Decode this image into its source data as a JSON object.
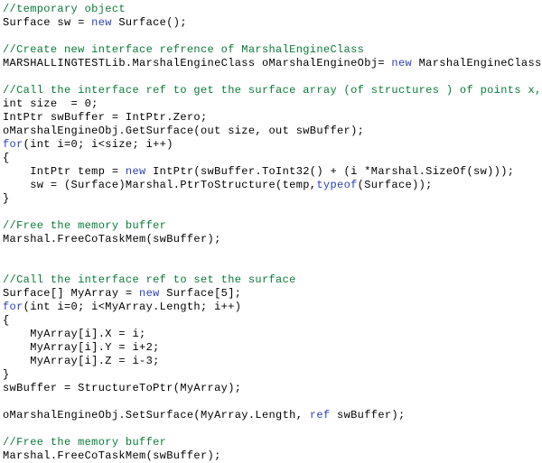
{
  "editor": {
    "language": "csharp",
    "background_color": "#ffffff",
    "default_text_color": "#000000",
    "comment_color": "#0a7a3a",
    "keyword_color": "#2b3fbd",
    "font_size_px": 12,
    "line_height_px": 15
  },
  "code": {
    "lines": [
      {
        "id": "line-1",
        "tokens": [
          {
            "t": "//temporary object",
            "k": "com"
          }
        ]
      },
      {
        "id": "line-2",
        "tokens": [
          {
            "t": "Surface sw = ",
            "k": "txt"
          },
          {
            "t": "new",
            "k": "kw"
          },
          {
            "t": " Surface();",
            "k": "txt"
          }
        ]
      },
      {
        "id": "line-3",
        "tokens": []
      },
      {
        "id": "line-4",
        "tokens": [
          {
            "t": "//Create new interface refrence of MarshalEngineClass",
            "k": "com"
          }
        ]
      },
      {
        "id": "line-5",
        "tokens": [
          {
            "t": "MARSHALLINGTESTLib.MarshalEngineClass oMarshalEngineObj= ",
            "k": "txt"
          },
          {
            "t": "new",
            "k": "kw"
          },
          {
            "t": " MarshalEngineClass();",
            "k": "txt"
          }
        ]
      },
      {
        "id": "line-6",
        "tokens": []
      },
      {
        "id": "line-7",
        "tokens": [
          {
            "t": "//Call the interface ref to get the surface array (of structures ) of points x,y,z",
            "k": "com"
          }
        ]
      },
      {
        "id": "line-8",
        "tokens": [
          {
            "t": "int size  = 0;",
            "k": "txt"
          }
        ]
      },
      {
        "id": "line-9",
        "tokens": [
          {
            "t": "IntPtr swBuffer = IntPtr.Zero;",
            "k": "txt"
          }
        ]
      },
      {
        "id": "line-10",
        "tokens": [
          {
            "t": "oMarshalEngineObj.GetSurface(out size, out swBuffer);",
            "k": "txt"
          }
        ]
      },
      {
        "id": "line-11",
        "tokens": [
          {
            "t": "for",
            "k": "kw"
          },
          {
            "t": "(int i=0; i<size; i++)",
            "k": "txt"
          }
        ]
      },
      {
        "id": "line-12",
        "tokens": [
          {
            "t": "{",
            "k": "txt"
          }
        ]
      },
      {
        "id": "line-13",
        "tokens": [
          {
            "t": "    IntPtr temp = ",
            "k": "txt"
          },
          {
            "t": "new",
            "k": "kw"
          },
          {
            "t": " IntPtr(swBuffer.ToInt32() + (i *Marshal.SizeOf(sw)));",
            "k": "txt"
          }
        ]
      },
      {
        "id": "line-14",
        "tokens": [
          {
            "t": "    sw = (Surface)Marshal.PtrToStructure(temp,",
            "k": "txt"
          },
          {
            "t": "typeof",
            "k": "kw"
          },
          {
            "t": "(Surface));",
            "k": "txt"
          }
        ]
      },
      {
        "id": "line-15",
        "tokens": [
          {
            "t": "}",
            "k": "txt"
          }
        ]
      },
      {
        "id": "line-16",
        "tokens": []
      },
      {
        "id": "line-17",
        "tokens": [
          {
            "t": "//Free the memory buffer",
            "k": "com"
          }
        ]
      },
      {
        "id": "line-18",
        "tokens": [
          {
            "t": "Marshal.FreeCoTaskMem(swBuffer);",
            "k": "txt"
          }
        ]
      },
      {
        "id": "line-19",
        "tokens": []
      },
      {
        "id": "line-20",
        "tokens": []
      },
      {
        "id": "line-21",
        "tokens": [
          {
            "t": "//Call the interface ref to set the surface",
            "k": "com"
          }
        ]
      },
      {
        "id": "line-22",
        "tokens": [
          {
            "t": "Surface[] MyArray = ",
            "k": "txt"
          },
          {
            "t": "new",
            "k": "kw"
          },
          {
            "t": " Surface[5];",
            "k": "txt"
          }
        ]
      },
      {
        "id": "line-23",
        "tokens": [
          {
            "t": "for",
            "k": "kw"
          },
          {
            "t": "(int i=0; i<MyArray.Length; i++)",
            "k": "txt"
          }
        ]
      },
      {
        "id": "line-24",
        "tokens": [
          {
            "t": "{",
            "k": "txt"
          }
        ]
      },
      {
        "id": "line-25",
        "tokens": [
          {
            "t": "    MyArray[i].X = i;",
            "k": "txt"
          }
        ]
      },
      {
        "id": "line-26",
        "tokens": [
          {
            "t": "    MyArray[i].Y = i+2;",
            "k": "txt"
          }
        ]
      },
      {
        "id": "line-27",
        "tokens": [
          {
            "t": "    MyArray[i].Z = i-3;",
            "k": "txt"
          }
        ]
      },
      {
        "id": "line-28",
        "tokens": [
          {
            "t": "}",
            "k": "txt"
          }
        ]
      },
      {
        "id": "line-29",
        "tokens": [
          {
            "t": "swBuffer = StructureToPtr(MyArray);",
            "k": "txt"
          }
        ]
      },
      {
        "id": "line-30",
        "tokens": []
      },
      {
        "id": "line-31",
        "tokens": [
          {
            "t": "oMarshalEngineObj.SetSurface(MyArray.Length, ",
            "k": "txt"
          },
          {
            "t": "ref",
            "k": "kw"
          },
          {
            "t": " swBuffer);",
            "k": "txt"
          }
        ]
      },
      {
        "id": "line-32",
        "tokens": []
      },
      {
        "id": "line-33",
        "tokens": [
          {
            "t": "//Free the memory buffer",
            "k": "com"
          }
        ]
      },
      {
        "id": "line-34",
        "tokens": [
          {
            "t": "Marshal.FreeCoTaskMem(swBuffer);",
            "k": "txt"
          }
        ]
      }
    ]
  }
}
